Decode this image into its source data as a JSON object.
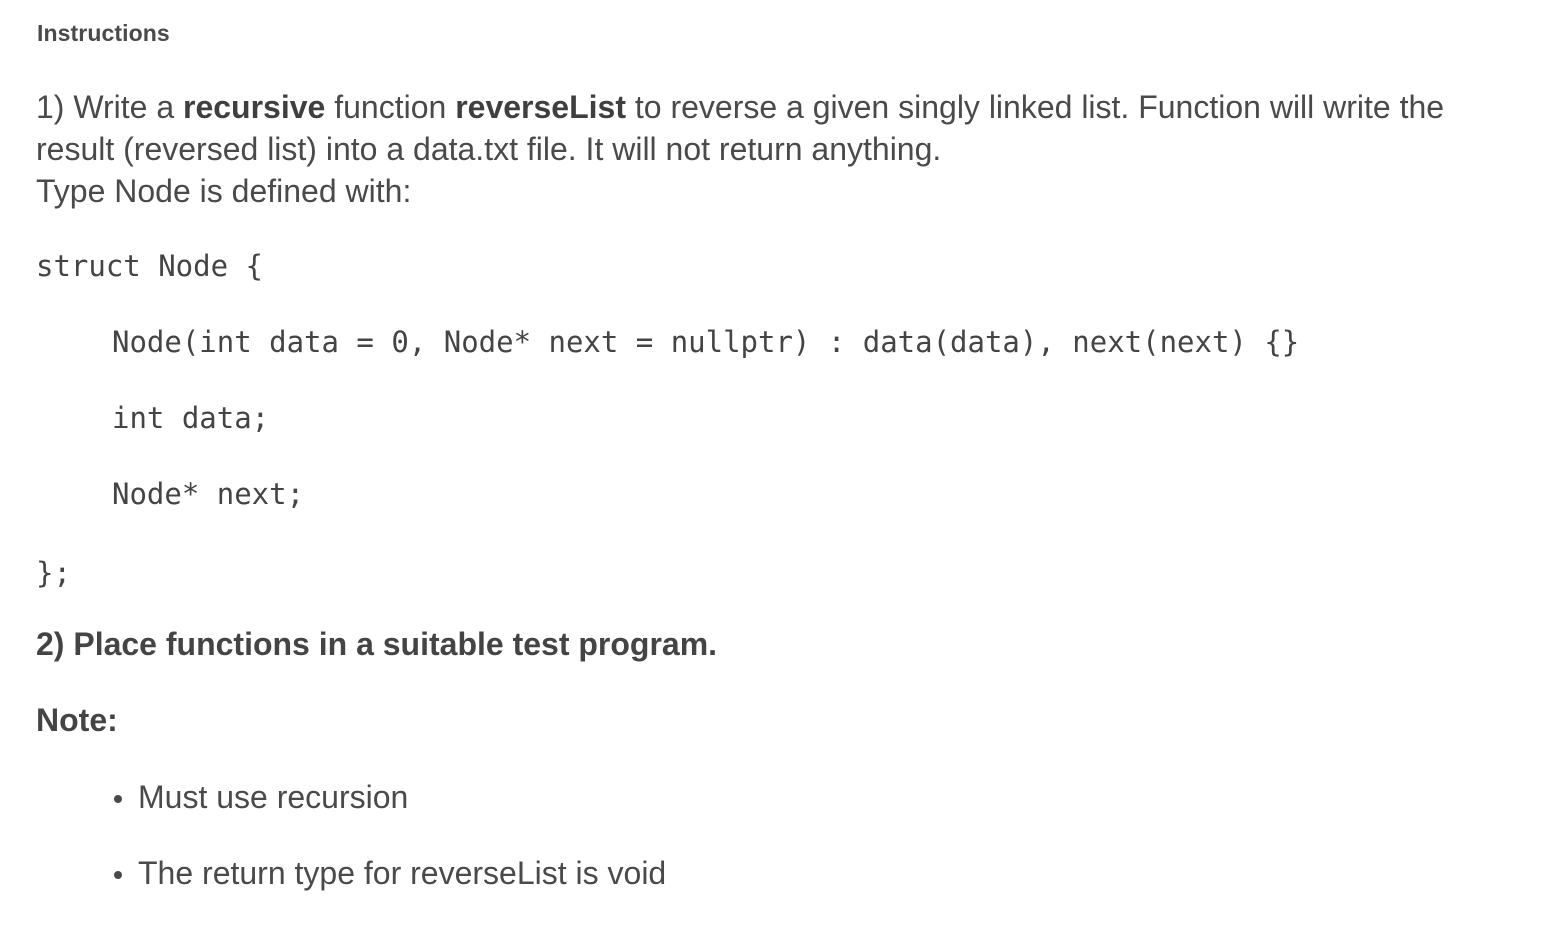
{
  "header": {
    "title": "Instructions"
  },
  "instructions": {
    "item1": {
      "prefix": "1) Write a ",
      "bold1": "recursive",
      "middle": " function ",
      "bold2": "reverseList",
      "suffix": " to reverse a given singly linked list. Function will write the result (reversed list) into a data.txt file. It will not return anything.",
      "type_line": "Type Node is defined with:"
    },
    "code": {
      "line1": "struct Node {",
      "line2": "Node(int data = 0, Node* next = nullptr) : data(data), next(next) {}",
      "line3": "int data;",
      "line4": "Node* next;",
      "line5": "};"
    },
    "item2": "2) Place functions in a suitable test program.",
    "note_label": "Note:",
    "notes": [
      "Must use recursion",
      "The return type for reverseList is void"
    ]
  }
}
